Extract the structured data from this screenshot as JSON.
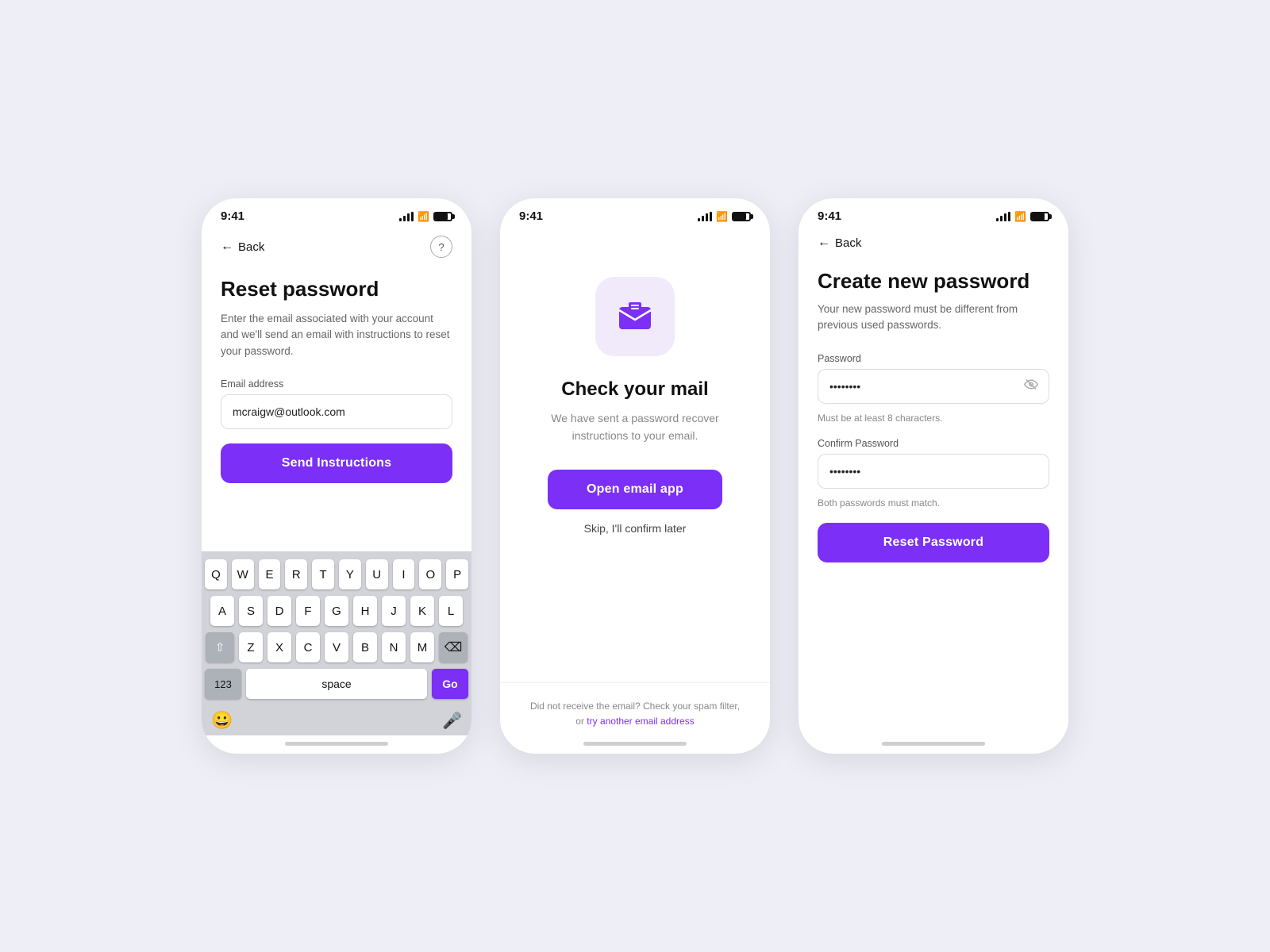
{
  "colors": {
    "purple": "#7b2ff7",
    "bg": "#eeeef7",
    "white": "#ffffff"
  },
  "screen1": {
    "time": "9:41",
    "back_label": "Back",
    "title": "Reset password",
    "description": "Enter the email associated with your account and we'll send an email with instructions to reset your password.",
    "email_label": "Email address",
    "email_value": "mcraigw@outlook.com",
    "send_button": "Send Instructions",
    "keyboard": {
      "row1": [
        "Q",
        "W",
        "E",
        "R",
        "T",
        "Y",
        "U",
        "I",
        "O",
        "P"
      ],
      "row2": [
        "A",
        "S",
        "D",
        "F",
        "G",
        "H",
        "J",
        "K",
        "L"
      ],
      "row3": [
        "Z",
        "X",
        "C",
        "V",
        "B",
        "N",
        "M"
      ],
      "key_123": "123",
      "key_space": "space",
      "key_go": "Go"
    }
  },
  "screen2": {
    "time": "9:41",
    "mail_icon_label": "email-envelope-icon",
    "title": "Check your mail",
    "description": "We have sent a password recover instructions to your email.",
    "open_email_button": "Open email app",
    "skip_label": "Skip, I'll confirm later",
    "footer_text": "Did not receive the email? Check your spam filter,",
    "footer_link_prefix": "or ",
    "footer_link": "try another email address"
  },
  "screen3": {
    "time": "9:41",
    "back_label": "Back",
    "title": "Create new password",
    "description": "Your new password must be different from previous used passwords.",
    "password_label": "Password",
    "password_value": "••••••••",
    "password_hint": "Must be at least 8 characters.",
    "confirm_label": "Confirm Password",
    "confirm_value": "••••••••",
    "confirm_hint": "Both passwords must match.",
    "reset_button": "Reset Password"
  }
}
